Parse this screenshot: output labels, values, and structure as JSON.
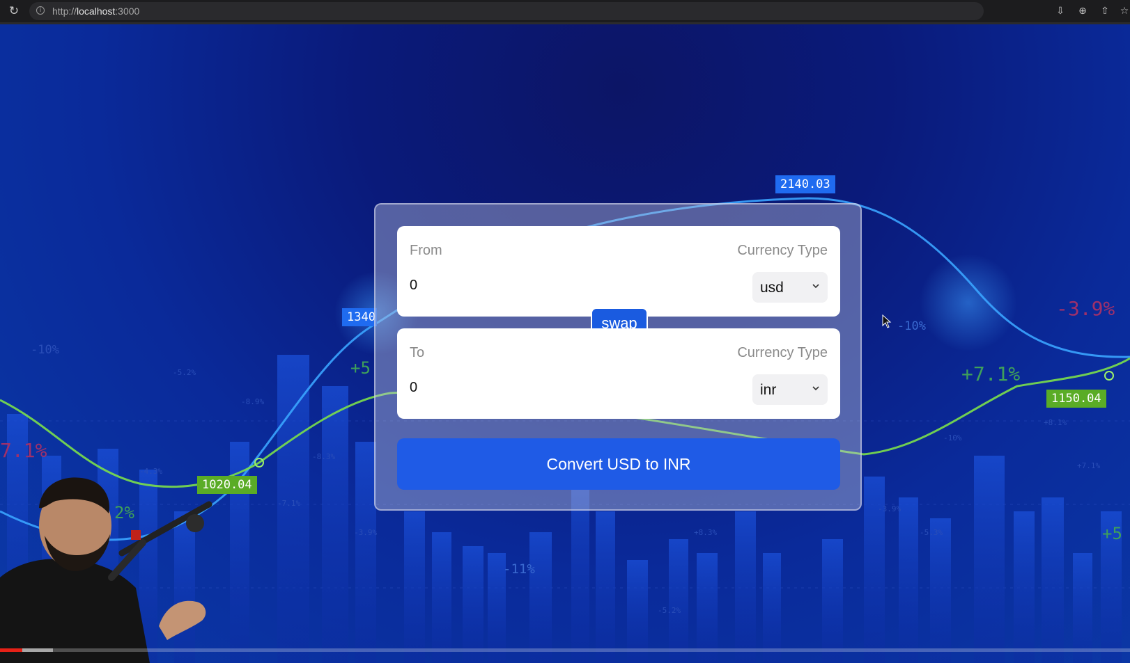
{
  "browser": {
    "url_prefix": "http://",
    "url_host": "localhost",
    "url_port": ":3000"
  },
  "background": {
    "price_tags": [
      "2140.03",
      "1340",
      "1020.04",
      "1150.04"
    ],
    "percentages": [
      "-3.9%",
      "+7.1%",
      "-10%",
      "+5",
      "-10%",
      "7.1%",
      "2%",
      "-11%",
      "+5",
      "-5.2%",
      "-8.9%",
      "-4.3%",
      "-8.3%",
      "-7.1%",
      "-3.9%",
      "+8.3%",
      "-5.3%",
      "-3.9%",
      "+8.1%",
      "-10%",
      "+7.1%",
      "-5.2%"
    ]
  },
  "converter": {
    "from": {
      "label": "From",
      "currency_label": "Currency Type",
      "amount": "0",
      "currency": "usd"
    },
    "swap_label": "swap",
    "to": {
      "label": "To",
      "currency_label": "Currency Type",
      "amount": "0",
      "currency": "inr"
    },
    "convert_label": "Convert USD to INR"
  },
  "colors": {
    "accent": "#1f5be6",
    "swap": "#1a5be0",
    "card_bg": "rgba(190,195,220,0.42)"
  },
  "video": {
    "progress_fraction": 0.02,
    "buffer_fraction": 0.047
  }
}
